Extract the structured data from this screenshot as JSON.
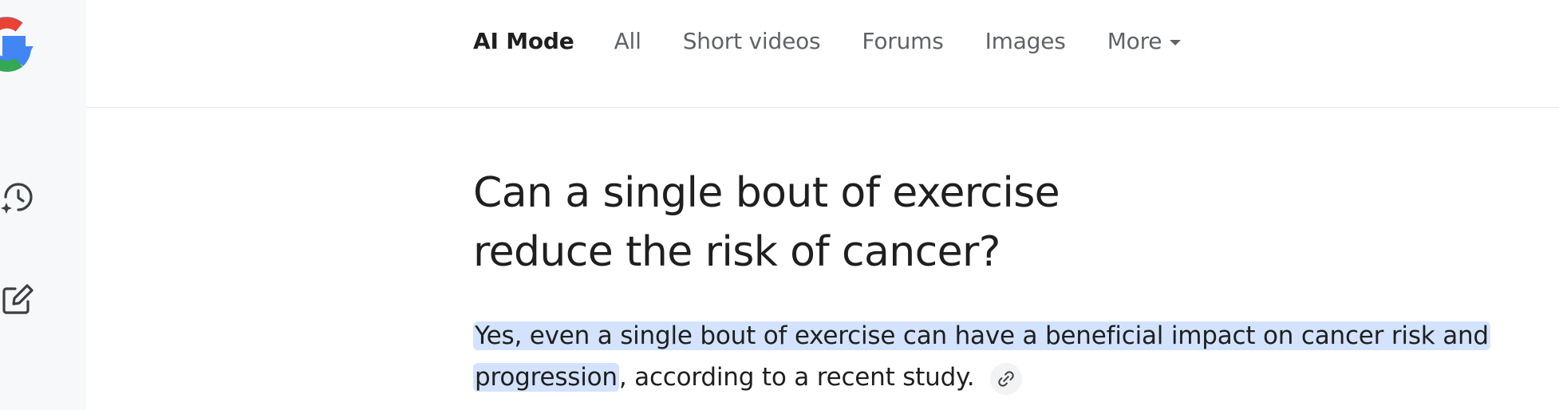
{
  "header": {
    "tabs": [
      {
        "label": "AI Mode",
        "active": true
      },
      {
        "label": "All",
        "active": false
      },
      {
        "label": "Short videos",
        "active": false
      },
      {
        "label": "Forums",
        "active": false
      },
      {
        "label": "Images",
        "active": false
      },
      {
        "label": "More",
        "active": false
      }
    ]
  },
  "sidebar": {
    "icons": [
      "google-logo",
      "history-icon",
      "new-chat-icon"
    ]
  },
  "main": {
    "question": "Can a single bout of exercise reduce the risk of cancer?",
    "answer": {
      "highlighted_part_1": "Yes, even a single bout of exercise can have a beneficial impact on cancer risk and",
      "highlighted_part_2": "progression",
      "rest": ", according to a recent study."
    }
  },
  "colors": {
    "highlight": "#d3e3fd",
    "sidebar_bg": "#f7f8fa",
    "text": "#1f1f1f",
    "muted": "#5f6368"
  }
}
